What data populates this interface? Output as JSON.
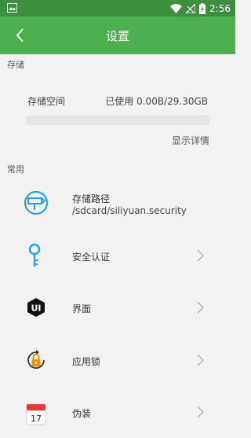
{
  "status_bar": {
    "time": "2:56",
    "icons": [
      "image-icon",
      "wifi-icon",
      "signal-icon",
      "battery-charging-icon"
    ]
  },
  "app_bar": {
    "title": "设置",
    "back_icon": "chevron-left-icon"
  },
  "storage_section": {
    "header": "存储",
    "label": "存储空间",
    "usage": "已使用 0.00B/29.30GB",
    "used_fraction": 0,
    "details_link": "显示详情"
  },
  "general_section": {
    "header": "常用",
    "items": [
      {
        "label": "存储路径",
        "subtitle": "/sdcard/siliyuan.security",
        "icon": "signpost-icon",
        "has_chevron": false
      },
      {
        "label": "安全认证",
        "icon": "key-icon",
        "has_chevron": true
      },
      {
        "label": "界面",
        "icon": "ui-badge-icon",
        "icon_text": "UI",
        "has_chevron": true
      },
      {
        "label": "应用锁",
        "icon": "app-lock-icon",
        "has_chevron": true
      },
      {
        "label": "伪装",
        "icon": "calendar-icon",
        "icon_text": "17",
        "has_chevron": true
      }
    ]
  },
  "colors": {
    "accent": "#4caf50",
    "status_bar": "#3d8f3f",
    "icon_blue": "#29a3d6"
  }
}
